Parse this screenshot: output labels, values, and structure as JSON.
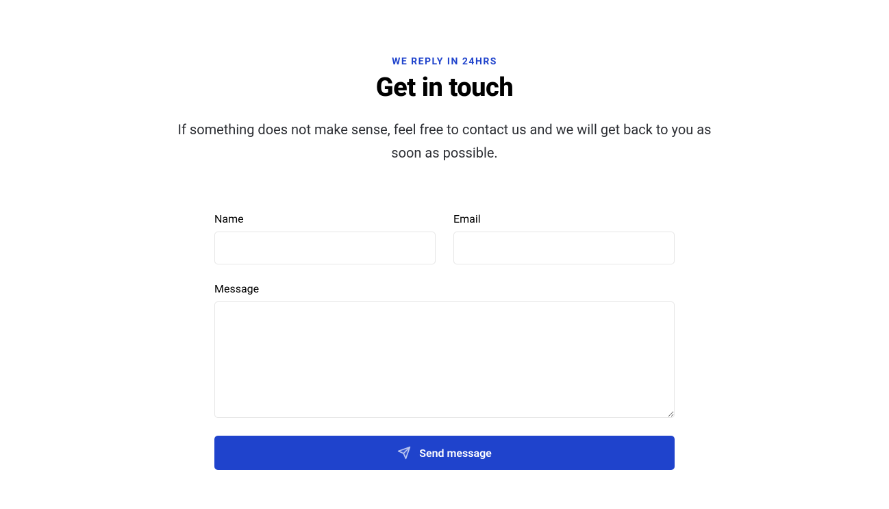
{
  "header": {
    "eyebrow": "WE REPLY IN 24HRS",
    "heading": "Get in touch",
    "subheading": "If something does not make sense, feel free to contact us and we will get back to you as soon as possible."
  },
  "form": {
    "name": {
      "label": "Name",
      "value": ""
    },
    "email": {
      "label": "Email",
      "value": ""
    },
    "message": {
      "label": "Message",
      "value": ""
    },
    "submit_label": "Send message"
  },
  "colors": {
    "accent": "#1F43CC"
  }
}
